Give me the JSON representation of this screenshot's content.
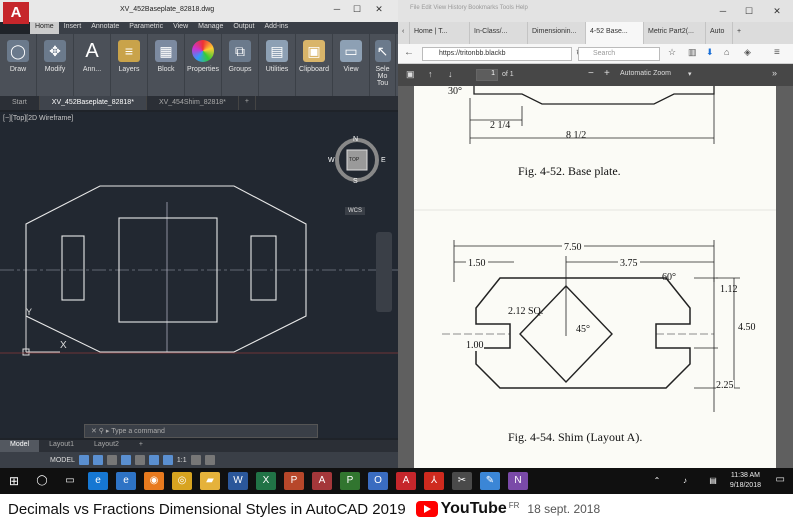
{
  "acad": {
    "title": "XV_452Baseplate_82818.dwg",
    "menu": [
      "Home",
      "Insert",
      "Annotate",
      "Parametric",
      "View",
      "Manage",
      "Output",
      "Add-ins"
    ],
    "ribbon": [
      "Draw",
      "Modify",
      "Ann...",
      "Layers",
      "Block",
      "Properties",
      "Groups",
      "Utilities",
      "Clipboard",
      "View"
    ],
    "ribbon_extra": "Sele Mo",
    "ribbon_extra2": "Tou",
    "tabs": [
      "Start",
      "XV_452Baseplate_82818*",
      "XV_454Shim_82818*"
    ],
    "viewport_label": "[−][Top][2D Wireframe]",
    "viewcube": {
      "top": "TOP",
      "n": "N",
      "s": "S",
      "e": "E",
      "w": "W"
    },
    "wcs": "WCS",
    "cmd_placeholder": "Type a command",
    "model_tabs": [
      "Model",
      "Layout1",
      "Layout2"
    ],
    "status_model": "MODEL",
    "status_scale": "1:1"
  },
  "browser": {
    "menu": "File  Edit  View  History  Bookmarks  Tools  Help",
    "tabs": [
      "Home | T...",
      "In-Class/...",
      "Dimensionin...",
      "4-52 Base...",
      "Metric Part2(...",
      "Auto"
    ],
    "url": "https://tritonbb.blackb",
    "search_placeholder": "Search",
    "pdf_page": "1",
    "pdf_of": "of 1",
    "pdf_zoom": "Automatic Zoom"
  },
  "pdf": {
    "fig1_caption": "Fig. 4-52. Base plate.",
    "fig1_dims": [
      "30°",
      "2 1/4",
      "8 1/2"
    ],
    "fig2_caption": "Fig. 4-54. Shim (Layout A).",
    "fig2_dims": {
      "overall": "7.50",
      "left": "1.50",
      "right": "3.75",
      "angle60": "60°",
      "top_right": "1.12",
      "sq": "2.12 SQ.",
      "angle45": "45°",
      "height": "4.50",
      "slot": "1.00",
      "bottom_right": "2.25"
    }
  },
  "taskbar": {
    "time": "11:38 AM",
    "date": "9/18/2018"
  },
  "video": {
    "title": "Decimals vs Fractions Dimensional Styles in AutoCAD 2019",
    "platform": "YouTube",
    "region": "FR",
    "date": "18 sept. 2018"
  }
}
